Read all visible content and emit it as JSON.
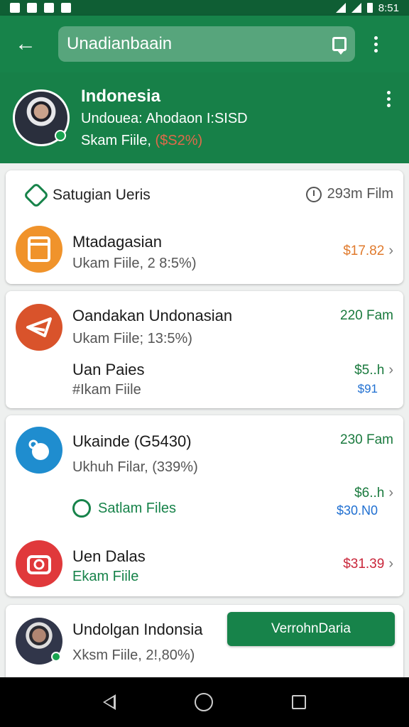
{
  "status_bar": {
    "time": "8:51"
  },
  "app_bar": {
    "search_value": "Unadianbaain"
  },
  "profile": {
    "name": "Indonesia",
    "subtitle": "Undouea: Ahodaon I:SISD",
    "file_label": "Skam Fiile, ",
    "file_pct": "($S2%)"
  },
  "card1": {
    "header_title": "Satugian Ueris",
    "header_right": "293m Film",
    "row": {
      "title": "Mtadagasian",
      "subtitle": "Ukam Fiile, 2 8:5%)",
      "amount": "$17.82"
    }
  },
  "card2": {
    "row1": {
      "title": "Oandakan Undonasian",
      "subtitle": "Ukam Fiile; 13:5%)",
      "right": "220 Fam"
    },
    "row2": {
      "title": "Uan Paies",
      "subtitle": "#Ikam Fiile",
      "amount": "$5..h",
      "amount2": "$91"
    }
  },
  "card3": {
    "row1": {
      "title": "Ukainde (G5430)",
      "subtitle": "Ukhuh Filar, (339%)",
      "right": "230 Fam"
    },
    "link": {
      "label": "Satlam Files",
      "amount": "$6..h",
      "amount2": "$30.N0"
    },
    "row2": {
      "title": "Uen Dalas",
      "subtitle": "Ekam Fiile",
      "amount": "$31.39"
    }
  },
  "card4": {
    "row": {
      "title": "Undolgan Indonsia",
      "subtitle": "Xksm Fiile, 2!,80%)",
      "button": "VerrohnDaria"
    }
  },
  "colors": {
    "primary": "#17834a",
    "dark": "#0f5e34",
    "orange": "#f0932b",
    "red_orange": "#d9532b",
    "blue": "#1f8dcf",
    "red": "#e0393b",
    "amount_orange": "#e07a2c",
    "amount_green": "#1a7a3e",
    "amount_blue": "#1f6fd1",
    "amount_red": "#c9263a"
  },
  "icons": {
    "back": "arrow-left-icon",
    "search_action": "chat-bubble-icon",
    "menu": "kebab-menu-icon",
    "header": "hexagon-icon",
    "clock": "clock-icon",
    "orange_app": "document-icon",
    "red_app": "plane-icon",
    "blue_app": "drop-icon",
    "red_camera": "camera-icon"
  }
}
